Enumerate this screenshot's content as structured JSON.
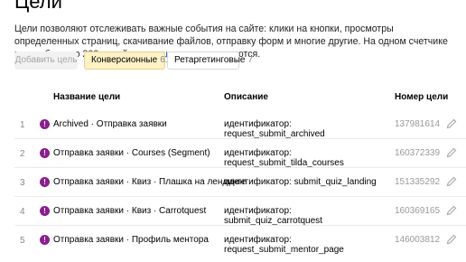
{
  "page": {
    "title": "Цели",
    "intro_text": "Цели позволяют отслеживать важные события на сайте: клики на кнопки, просмотры определенных страниц, скачивание файлов, отправку форм и многие другие. На одном счетчике может быть до 200 целей — ",
    "intro_link": "автоцели",
    "intro_tail": " не учитываются."
  },
  "toolbar": {
    "add_label": "Добавить цель",
    "tabs": [
      {
        "label": "Конверсионные",
        "count": "61"
      },
      {
        "label": "Ретаргетинговые",
        "count": "7"
      }
    ]
  },
  "table": {
    "headers": {
      "name": "Название цели",
      "description": "Описание",
      "id": "Номер цели"
    },
    "rows": [
      {
        "num": "1",
        "name": "Archived · Отправка заявки",
        "description": "идентификатор: request_submit_archived",
        "id": "137981614"
      },
      {
        "num": "2",
        "name": "Отправка заявки · Courses (Segment)",
        "description": "идентификатор: request_submit_tilda_courses",
        "id": "160372339"
      },
      {
        "num": "3",
        "name": "Отправка заявки · Квиз · Плашка на лендинге",
        "description": "идентификатор: submit_quiz_landing",
        "id": "151335292"
      },
      {
        "num": "4",
        "name": "Отправка заявки · Квиз · Carrotquest",
        "description": "идентификатор: submit_quiz_carrotquest",
        "id": "160369165"
      },
      {
        "num": "5",
        "name": "Отправка заявки · Профиль ментора",
        "description": "идентификатор: request_submit_mentor_page",
        "id": "146003812"
      }
    ]
  },
  "colors": {
    "accent_link": "#0a64c8",
    "goal_icon": "#8a1d8f",
    "active_tab": "#fff2c5"
  },
  "icons": {
    "goal": "exclamation-circle-icon",
    "edit": "pencil-icon"
  }
}
